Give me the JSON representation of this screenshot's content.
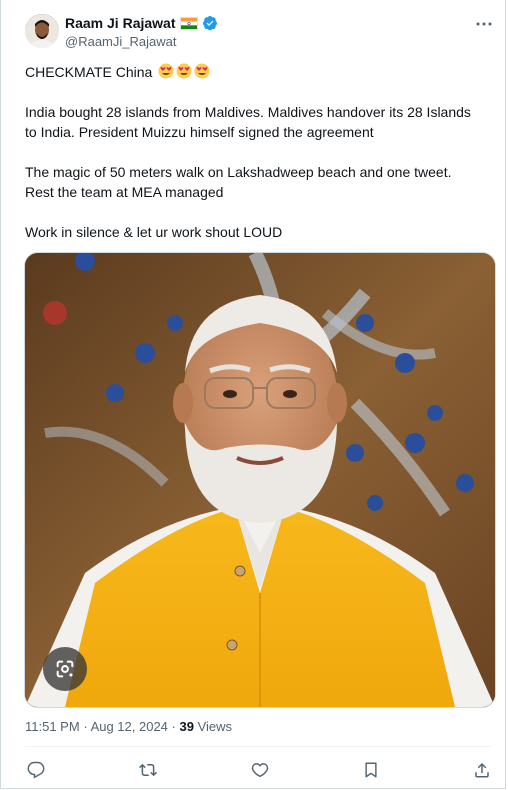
{
  "author": {
    "name": "Raam Ji Rajawat",
    "handle": "@RaamJi_Rajawat",
    "flag_icon": "india-flag-icon",
    "verified_icon": "verified-badge-icon",
    "verified_color": "#1d9bf0"
  },
  "tweet": {
    "line1": "CHECKMATE China",
    "line1_emojis": [
      "heart-eyes-emoji",
      "heart-eyes-emoji",
      "heart-eyes-emoji"
    ],
    "paragraph2": "India bought 28 islands from Maldives. Maldives handover its 28 Islands\nto India. President Muizzu himself signed the agreement",
    "paragraph3": "The magic of 50 meters walk on Lakshadweep beach and one tweet.\nRest the team at MEA managed",
    "paragraph4": "Work in silence & let ur work shout LOUD"
  },
  "media": {
    "description_icon": "photo-of-man-in-saffron-vest",
    "lens_button_icon": "google-lens-icon"
  },
  "meta": {
    "time": "11:51 PM",
    "separator": "·",
    "date": "Aug 12, 2024",
    "views_count": "39",
    "views_label": "Views"
  },
  "actions": {
    "icons": [
      "reply-icon",
      "retweet-icon",
      "like-icon",
      "bookmark-icon",
      "share-icon"
    ]
  },
  "colors": {
    "text_primary": "#0f1419",
    "text_secondary": "#536471",
    "border": "#cfd9de",
    "verified": "#1d9bf0"
  }
}
